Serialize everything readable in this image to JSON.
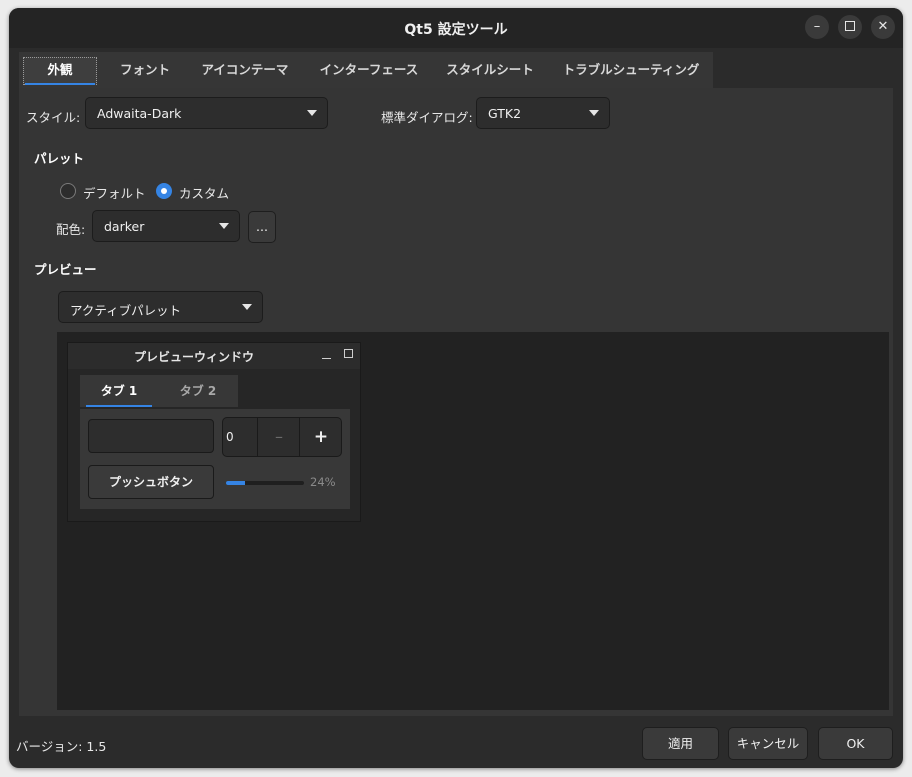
{
  "window": {
    "title": "Qt5 設定ツール"
  },
  "tabs": [
    {
      "label": "外観",
      "active": true
    },
    {
      "label": "フォント"
    },
    {
      "label": "アイコンテーマ"
    },
    {
      "label": "インターフェース"
    },
    {
      "label": "スタイルシート"
    },
    {
      "label": "トラブルシューティング"
    }
  ],
  "style": {
    "label": "スタイル:",
    "value": "Adwaita-Dark"
  },
  "dialog": {
    "label": "標準ダイアログ:",
    "value": "GTK2"
  },
  "palette": {
    "heading": "パレット",
    "default_label": "デフォルト",
    "custom_label": "カスタム",
    "selected": "custom",
    "color_label": "配色:",
    "color_value": "darker",
    "more_label": "..."
  },
  "preview": {
    "heading": "プレビュー",
    "palette_select": "アクティブパレット",
    "window_title": "プレビューウィンドウ",
    "tab1": "タブ 1",
    "tab2": "タブ 2",
    "spin_value": "0",
    "push_button": "プッシュボタン",
    "progress": 24,
    "progress_text": "24%"
  },
  "footer": {
    "version": "バージョン: 1.5",
    "apply": "適用",
    "cancel": "キャンセル",
    "ok": "OK"
  },
  "colors": {
    "accent": "#3584e4",
    "window_bg": "#2b2b2b",
    "panel_bg": "#353535",
    "preview_bg": "#222222"
  }
}
